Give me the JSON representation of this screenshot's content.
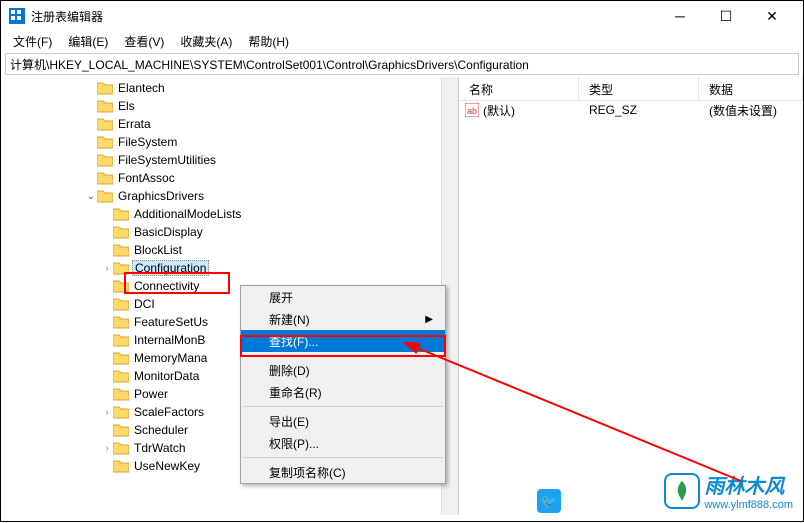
{
  "title": "注册表编辑器",
  "menus": [
    "文件(F)",
    "编辑(E)",
    "查看(V)",
    "收藏夹(A)",
    "帮助(H)"
  ],
  "address": "计算机\\HKEY_LOCAL_MACHINE\\SYSTEM\\ControlSet001\\Control\\GraphicsDrivers\\Configuration",
  "tree": {
    "items": [
      {
        "label": "Elantech",
        "depth": 5
      },
      {
        "label": "Els",
        "depth": 5
      },
      {
        "label": "Errata",
        "depth": 5
      },
      {
        "label": "FileSystem",
        "depth": 5
      },
      {
        "label": "FileSystemUtilities",
        "depth": 5
      },
      {
        "label": "FontAssoc",
        "depth": 5
      },
      {
        "label": "GraphicsDrivers",
        "depth": 5,
        "open": true
      },
      {
        "label": "AdditionalModeLists",
        "depth": 6
      },
      {
        "label": "BasicDisplay",
        "depth": 6
      },
      {
        "label": "BlockList",
        "depth": 6
      },
      {
        "label": "Configuration",
        "depth": 6,
        "selected": true,
        "expand": true
      },
      {
        "label": "Connectivity",
        "depth": 6
      },
      {
        "label": "DCI",
        "depth": 6
      },
      {
        "label": "FeatureSetUs",
        "depth": 6,
        "cut": true
      },
      {
        "label": "InternalMonB",
        "depth": 6,
        "cut": true
      },
      {
        "label": "MemoryMana",
        "depth": 6,
        "cut": true
      },
      {
        "label": "MonitorData",
        "depth": 6,
        "cut": true
      },
      {
        "label": "Power",
        "depth": 6
      },
      {
        "label": "ScaleFactors",
        "depth": 6,
        "expand": true
      },
      {
        "label": "Scheduler",
        "depth": 6
      },
      {
        "label": "TdrWatch",
        "depth": 6,
        "expand": true
      },
      {
        "label": "UseNewKey",
        "depth": 6
      }
    ]
  },
  "list": {
    "headers": {
      "name": "名称",
      "type": "类型",
      "data": "数据"
    },
    "rows": [
      {
        "name": "(默认)",
        "type": "REG_SZ",
        "data": "(数值未设置)"
      }
    ]
  },
  "context_menu": {
    "items": [
      {
        "label": "展开"
      },
      {
        "label": "新建(N)",
        "submenu": true
      },
      {
        "label": "查找(F)...",
        "hover": true
      },
      {
        "sep": true
      },
      {
        "label": "删除(D)"
      },
      {
        "label": "重命名(R)"
      },
      {
        "sep": true
      },
      {
        "label": "导出(E)"
      },
      {
        "label": "权限(P)..."
      },
      {
        "sep": true
      },
      {
        "label": "复制项名称(C)"
      }
    ]
  },
  "logo": {
    "brand1": "雨林木风",
    "url": "www.ylmf888.com"
  }
}
